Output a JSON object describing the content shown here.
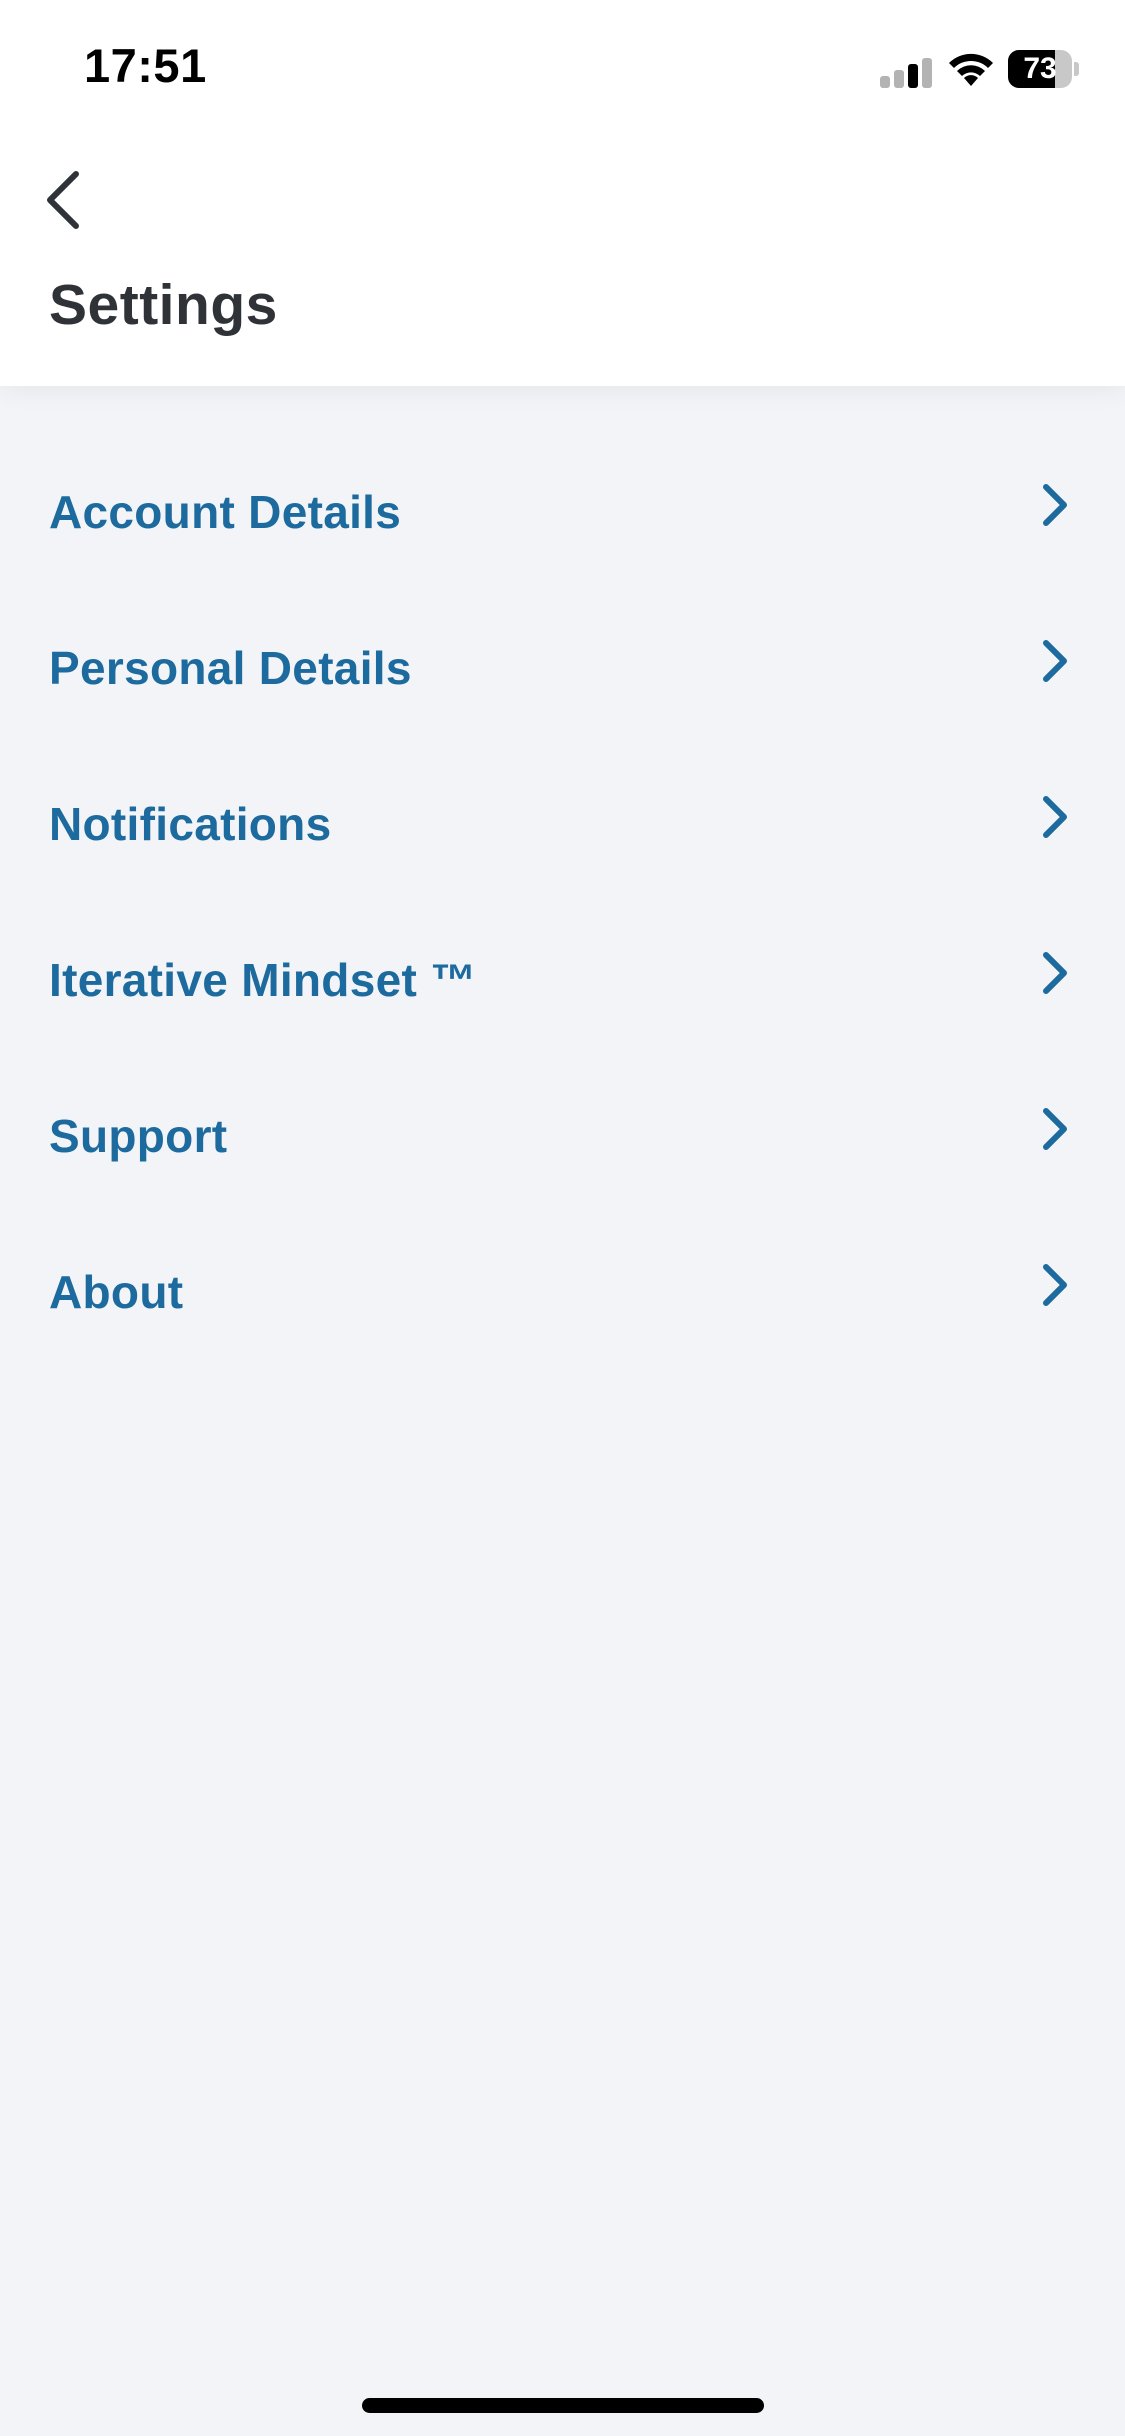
{
  "status_bar": {
    "time": "17:51",
    "battery_level": "73",
    "battery_fraction": 0.73,
    "cell_signal_icon": "cell-signal-icon",
    "wifi_icon": "wifi-icon",
    "battery_icon": "battery-icon"
  },
  "header": {
    "back_icon": "chevron-left-icon",
    "title": "Settings"
  },
  "menu": {
    "chevron_icon": "chevron-right-icon",
    "items": [
      {
        "label": "Account Details"
      },
      {
        "label": "Personal Details"
      },
      {
        "label": "Notifications"
      },
      {
        "label": "Iterative Mindset ™"
      },
      {
        "label": "Support"
      },
      {
        "label": "About"
      }
    ]
  },
  "colors": {
    "background": "#f2f4f7",
    "header_background": "#ffffff",
    "title_text": "#2f3338",
    "accent": "#1c6a9e"
  }
}
